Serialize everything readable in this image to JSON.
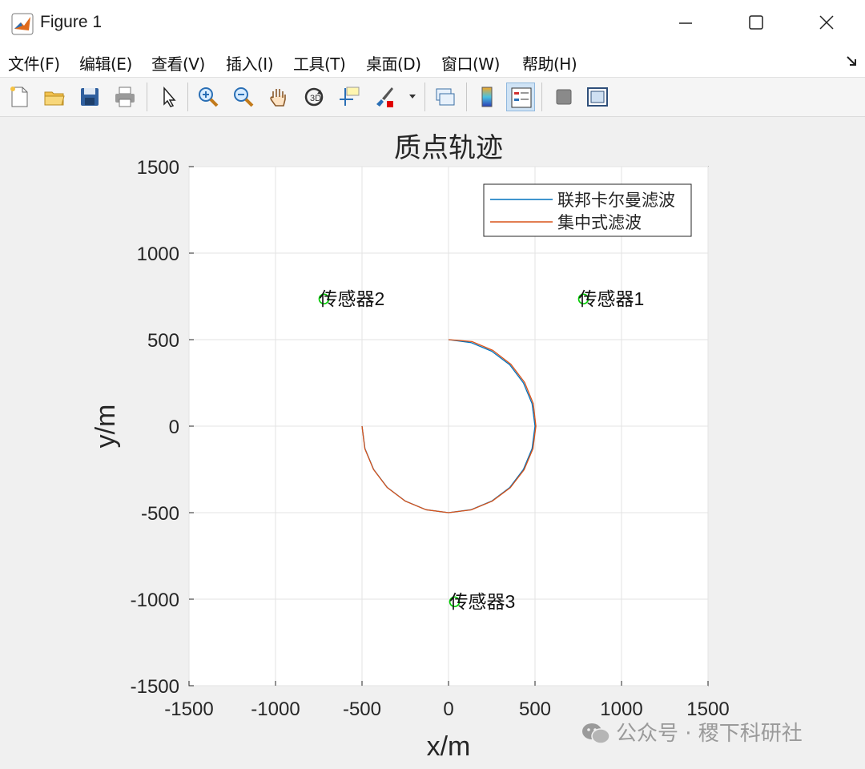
{
  "window": {
    "title": "Figure 1",
    "controls": {
      "minimize": "minimize",
      "maximize": "maximize",
      "close": "close"
    }
  },
  "menu": {
    "items": [
      "文件(F)",
      "编辑(E)",
      "查看(V)",
      "插入(I)",
      "工具(T)",
      "桌面(D)",
      "窗口(W)",
      "帮助(H)"
    ]
  },
  "toolbar": {
    "icons": [
      "new-figure-icon",
      "open-icon",
      "save-icon",
      "print-icon",
      "pointer-icon",
      "zoom-in-icon",
      "zoom-out-icon",
      "pan-hand-icon",
      "rotate-3d-icon",
      "data-cursor-icon",
      "brush-icon",
      "link-icon",
      "colorbar-icon",
      "legend-icon",
      "hide-plot-tools-icon",
      "show-plot-tools-icon"
    ]
  },
  "chart_data": {
    "type": "line",
    "title": "质点轨迹",
    "xlabel": "x/m",
    "ylabel": "y/m",
    "xlim": [
      -1500,
      1500
    ],
    "ylim": [
      -1500,
      1500
    ],
    "xticks": [
      "-1500",
      "-1000",
      "-500",
      "0",
      "500",
      "1000",
      "1500"
    ],
    "yticks": [
      "1500",
      "1000",
      "500",
      "0",
      "-500",
      "-1000",
      "-1500"
    ],
    "grid": true,
    "legend_position": "top-right",
    "series": [
      {
        "name": "联邦卡尔曼滤波",
        "color": "#0072BD",
        "description_points": "circle radius 500 centered at origin from angle 90° clockwise to 180°",
        "x": [
          0,
          130,
          250,
          354,
          433,
          483,
          500,
          483,
          433,
          354,
          250,
          130,
          0,
          -130,
          -250,
          -354,
          -433,
          -483,
          -500
        ],
        "y": [
          500,
          483,
          433,
          354,
          250,
          130,
          0,
          -130,
          -250,
          -354,
          -433,
          -483,
          -500,
          -483,
          -433,
          -354,
          -250,
          -130,
          0
        ]
      },
      {
        "name": "集中式滤波",
        "color": "#D95319",
        "x": [
          0,
          135,
          256,
          360,
          440,
          490,
          505,
          488,
          437,
          357,
          252,
          131,
          0,
          -131,
          -251,
          -355,
          -434,
          -484,
          -500
        ],
        "y": [
          500,
          489,
          438,
          358,
          253,
          131,
          0,
          -131,
          -252,
          -356,
          -434,
          -484,
          -500,
          -483,
          -433,
          -354,
          -250,
          -130,
          0
        ]
      }
    ],
    "sensors": [
      {
        "label": "传感器1",
        "x": 780,
        "y": 735,
        "marker_color": "#00cc00"
      },
      {
        "label": "传感器2",
        "x": -720,
        "y": 735,
        "marker_color": "#00cc00"
      },
      {
        "label": "传感器3",
        "x": 35,
        "y": -1015,
        "marker_color": "#00cc00"
      }
    ]
  },
  "watermark": "公众号 · 稷下科研社"
}
